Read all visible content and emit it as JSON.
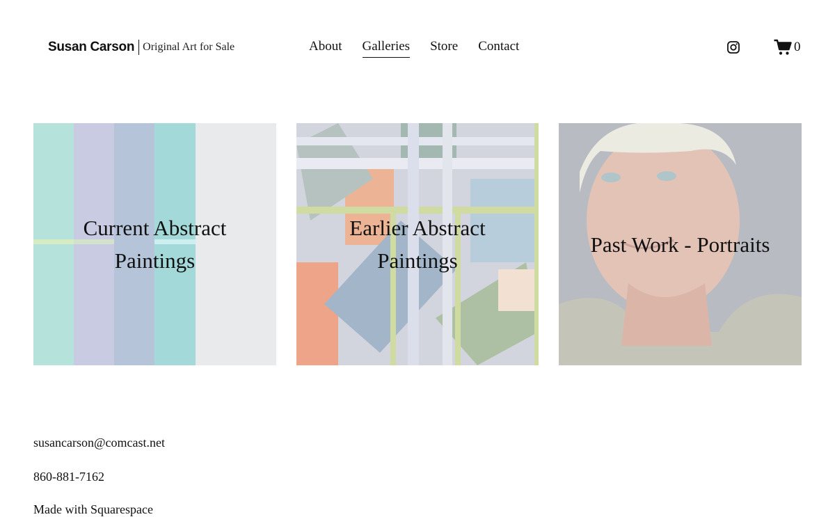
{
  "header": {
    "site_name": "Susan Carson",
    "tagline": "Original Art for Sale",
    "nav": [
      {
        "label": "About"
      },
      {
        "label": "Galleries",
        "active": true
      },
      {
        "label": "Store"
      },
      {
        "label": "Contact"
      }
    ],
    "cart_count": "0",
    "icons": [
      "instagram-icon",
      "cart-icon"
    ]
  },
  "galleries": [
    {
      "title": "Current Abstract Paintings"
    },
    {
      "title": "Earlier Abstract Paintings"
    },
    {
      "title": "Past Work - Portraits"
    }
  ],
  "footer": {
    "email": "susancarson@comcast.net",
    "phone": "860-881-7162",
    "made_with": "Made with Squarespace"
  }
}
